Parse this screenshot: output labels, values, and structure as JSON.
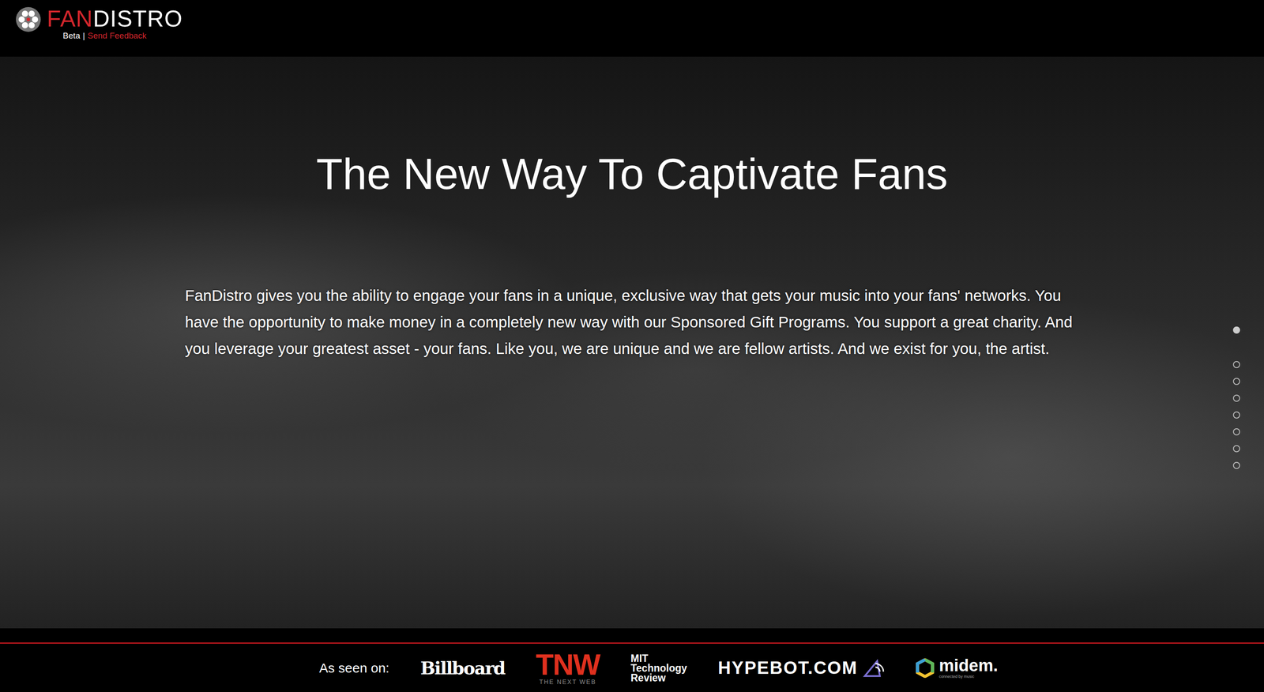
{
  "header": {
    "brand": [
      "FAN",
      "DISTRO"
    ],
    "beta": "Beta",
    "separator": "|",
    "feedback": "Send Feedback"
  },
  "hero": {
    "title": "The New Way To Captivate Fans",
    "body": "FanDistro gives you the ability to engage your fans in a unique, exclusive way that gets your music into your fans' networks. You have the opportunity to make money in a completely new way with our Sponsored Gift Programs. You support a great charity. And you leverage your greatest asset - your fans. Like you, we are unique and we are fellow artists. And we exist for you, the artist.",
    "slides": [
      {
        "selected": true
      },
      {
        "selected": false
      },
      {
        "selected": false
      },
      {
        "selected": false
      },
      {
        "selected": false
      },
      {
        "selected": false
      },
      {
        "selected": false
      },
      {
        "selected": false
      }
    ]
  },
  "footer": {
    "label": "As seen on:",
    "press": [
      {
        "kind": "billboard",
        "lines": [
          "Billboard"
        ]
      },
      {
        "kind": "tnw",
        "lines": [
          "TNW",
          "THE NEXT WEB"
        ]
      },
      {
        "kind": "mit",
        "lines": [
          "MIT",
          "Technology",
          "Review"
        ]
      },
      {
        "kind": "hypebot",
        "lines": [
          "HYPEBOT.COM"
        ]
      },
      {
        "kind": "midem",
        "lines": [
          "midem.",
          "connected by music"
        ]
      }
    ]
  }
}
